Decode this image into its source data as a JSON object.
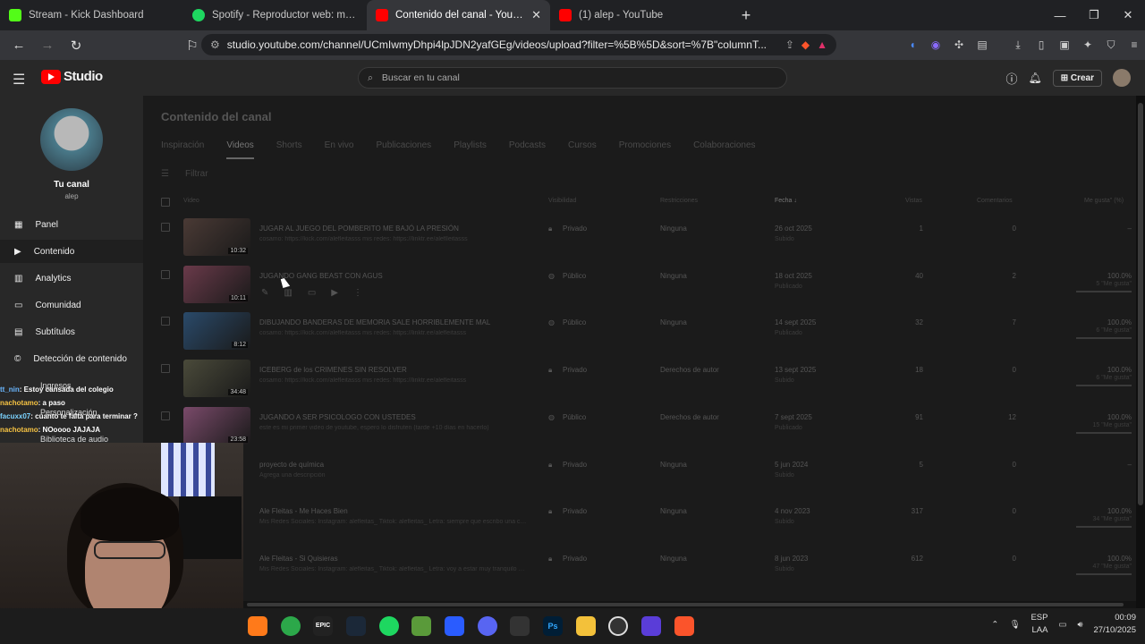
{
  "browser": {
    "tabs": [
      {
        "title": "Stream - Kick Dashboard",
        "color": "#53fc18"
      },
      {
        "title": "Spotify - Reproductor web: música p",
        "color": "#1ed760"
      },
      {
        "title": "Contenido del canal - YouTube S",
        "color": "#ff0000"
      },
      {
        "title": "(1) alep - YouTube",
        "color": "#ff0000"
      }
    ],
    "url": "studio.youtube.com/channel/UCmIwmyDhpi4lpJDN2yafGEg/videos/upload?filter=%5B%5D&sort=%7B\"columnT..."
  },
  "header": {
    "logo_text": "Studio",
    "search_placeholder": "Buscar en tu canal",
    "create_label": "Crear"
  },
  "sidebar": {
    "channel_title": "Tu canal",
    "channel_name": "alep",
    "items": [
      {
        "label": "Panel",
        "icon": "dashboard-icon"
      },
      {
        "label": "Contenido",
        "icon": "content-icon"
      },
      {
        "label": "Analytics",
        "icon": "analytics-icon"
      },
      {
        "label": "Comunidad",
        "icon": "community-icon"
      },
      {
        "label": "Subtítulos",
        "icon": "subtitles-icon"
      },
      {
        "label": "Detección de contenido",
        "icon": "copyright-icon"
      }
    ],
    "obscured": [
      "Ingresos",
      "Personalización",
      "Biblioteca de audio"
    ]
  },
  "main": {
    "title": "Contenido del canal",
    "tabs": [
      "Inspiración",
      "Videos",
      "Shorts",
      "En vivo",
      "Publicaciones",
      "Playlists",
      "Podcasts",
      "Cursos",
      "Promociones",
      "Colaboraciones"
    ],
    "filter_label": "Filtrar",
    "columns": {
      "video": "Video",
      "visibility": "Visibilidad",
      "restrictions": "Restricciones",
      "date": "Fecha",
      "views": "Vistas",
      "comments": "Comentarios",
      "likes": "Me gusta\" (%)"
    },
    "rows": [
      {
        "title": "JUGAR AL JUEGO DEL POMBERITO ME BAJÓ LA PRESIÓN",
        "desc": "cosamo: https://kick.com/alefleitasss mis redes: https://linktr.ee/aleflleitasss",
        "duration": "10:32",
        "visibility": "Privado",
        "restriction": "Ninguna",
        "date": "26 oct 2025",
        "date_sub": "Subido",
        "views": "1",
        "comments": "0",
        "likes": "–",
        "likes_sub": ""
      },
      {
        "title": "JUGANDO GANG BEAST CON AGUS",
        "desc": "",
        "duration": "10:11",
        "visibility": "Público",
        "restriction": "Ninguna",
        "date": "18 oct 2025",
        "date_sub": "Publicado",
        "views": "40",
        "comments": "2",
        "likes": "100.0%",
        "likes_sub": "5 \"Me gusta\""
      },
      {
        "title": "DIBUJANDO BANDERAS DE MEMORIA SALE HORRIBLEMENTE MAL",
        "desc": "cosamo: https://kick.com/alefleitasss mis redes: https://linktr.ee/alefleitasss",
        "duration": "8:12",
        "visibility": "Público",
        "restriction": "Ninguna",
        "date": "14 sept 2025",
        "date_sub": "Publicado",
        "views": "32",
        "comments": "7",
        "likes": "100.0%",
        "likes_sub": "6 \"Me gusta\""
      },
      {
        "title": "ICEBERG de los CRIMENES SIN RESOLVER",
        "desc": "cosamo: https://kick.com/alefleitasss mis redes: https://linktr.ee/alefleitasss",
        "duration": "34:48",
        "visibility": "Privado",
        "restriction": "Derechos de autor",
        "date": "13 sept 2025",
        "date_sub": "Subido",
        "views": "18",
        "comments": "0",
        "likes": "100.0%",
        "likes_sub": "6 \"Me gusta\""
      },
      {
        "title": "JUGANDO A SER PSICOLOGO CON USTEDES",
        "desc": "este es mi primer video de youtube, espero lo disfruten (tarde +10 días en hacerlo)",
        "duration": "23:58",
        "visibility": "Público",
        "restriction": "Derechos de autor",
        "date": "7 sept 2025",
        "date_sub": "Publicado",
        "views": "91",
        "comments": "12",
        "likes": "100.0%",
        "likes_sub": "15 \"Me gusta\""
      },
      {
        "title": "proyecto de química",
        "desc": "Agrega una descripción",
        "duration": "",
        "visibility": "Privado",
        "restriction": "Ninguna",
        "date": "5 jun 2024",
        "date_sub": "Subido",
        "views": "5",
        "comments": "0",
        "likes": "–",
        "likes_sub": ""
      },
      {
        "title": "Ale Fleitas - Me Haces Bien",
        "desc": "Mis Redes Sociales: Instagram: alefleitas_ Tiktok: alefleitas_ Letra: siempre que escribo una canción pienso en ti",
        "duration": "",
        "visibility": "Privado",
        "restriction": "Ninguna",
        "date": "4 nov 2023",
        "date_sub": "Subido",
        "views": "317",
        "comments": "0",
        "likes": "100.0%",
        "likes_sub": "34 \"Me gusta\""
      },
      {
        "title": "Ale Fleitas - Si Quisieras",
        "desc": "Mis Redes Sociales: Instagram: alefleitas_ Tiktok: alefleitas_ Letra: voy a estar muy tranquilo porque siempre estas",
        "duration": "",
        "visibility": "Privado",
        "restriction": "Ninguna",
        "date": "8 jun 2023",
        "date_sub": "Subido",
        "views": "612",
        "comments": "0",
        "likes": "100.0%",
        "likes_sub": "47 \"Me gusta\""
      }
    ]
  },
  "overlay_chat": [
    {
      "user": "tt_nin",
      "msg": ": Estoy cansada del colegio"
    },
    {
      "user": "nachotamo",
      "msg": ": a paso"
    },
    {
      "user": "facuxx07",
      "msg": ": cuanto te falta para terminar ?"
    },
    {
      "user": "nachotamo",
      "msg": ": NOoooo JAJAJA"
    }
  ],
  "taskbar": {
    "lang": "ESP",
    "lang_sub": "LAA",
    "time": "00:09",
    "date": "27/10/2025"
  }
}
